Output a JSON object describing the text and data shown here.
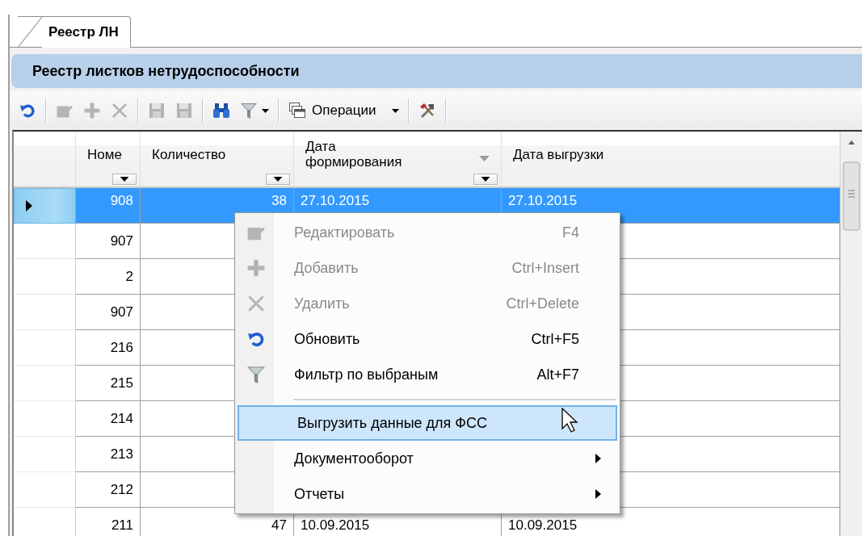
{
  "tab": {
    "label": "Реестр ЛН",
    "selected": true
  },
  "panel_title": "Реестр листков нетрудоспособности",
  "toolbar": [
    {
      "kind": "icon",
      "disabled": false
    },
    {
      "kind": "separator"
    },
    {
      "kind": "icon",
      "disabled": true
    },
    {
      "kind": "icon",
      "disabled": true
    },
    {
      "kind": "icon",
      "disabled": true
    },
    {
      "kind": "separator"
    },
    {
      "kind": "icon",
      "disabled": true
    },
    {
      "kind": "icon",
      "disabled": true
    },
    {
      "kind": "separator"
    },
    {
      "kind": "icon",
      "disabled": false
    },
    {
      "kind": "dropdown",
      "disabled": false
    },
    {
      "kind": "separator"
    },
    {
      "kind": "menu",
      "label": "Операции",
      "disabled": false
    },
    {
      "kind": "separator"
    },
    {
      "kind": "icon",
      "disabled": false
    },
    {
      "kind": "separator"
    }
  ],
  "table": {
    "columns": [
      {
        "label": "Номе",
        "filter": true,
        "sorted": false
      },
      {
        "label": "Количество",
        "filter": true,
        "sorted": false
      },
      {
        "label": "Дата\nформирования",
        "filter": true,
        "sorted": true
      },
      {
        "label": "Дата выгрузки",
        "filter": false,
        "sorted": false
      }
    ],
    "rows": [
      {
        "selected": true,
        "cells": [
          "908",
          "38",
          "27.10.2015",
          "27.10.2015"
        ]
      },
      {
        "selected": false,
        "cells": [
          "907"
        ]
      },
      {
        "selected": false,
        "cells": [
          "2"
        ]
      },
      {
        "selected": false,
        "cells": [
          "907"
        ]
      },
      {
        "selected": false,
        "cells": [
          "216"
        ]
      },
      {
        "selected": false,
        "cells": [
          "215"
        ]
      },
      {
        "selected": false,
        "cells": [
          "214"
        ]
      },
      {
        "selected": false,
        "cells": [
          "213"
        ]
      },
      {
        "selected": false,
        "cells": [
          "212"
        ]
      },
      {
        "selected": false,
        "cells": [
          "211",
          "47",
          "10.09.2015",
          "10.09.2015"
        ]
      }
    ]
  },
  "context_menu": {
    "items": [
      {
        "kind": "item",
        "label": "Редактировать",
        "shortcut": "F4",
        "disabled": true,
        "selected": false,
        "submenu": false
      },
      {
        "kind": "item",
        "label": "Добавить",
        "shortcut": "Ctrl+Insert",
        "disabled": true,
        "selected": false,
        "submenu": false
      },
      {
        "kind": "item",
        "label": "Удалить",
        "shortcut": "Ctrl+Delete",
        "disabled": true,
        "selected": false,
        "submenu": false
      },
      {
        "kind": "item",
        "label": "Обновить",
        "shortcut": "Ctrl+F5",
        "disabled": false,
        "selected": false,
        "submenu": false
      },
      {
        "kind": "item",
        "label": "Фильтр по выбраным",
        "shortcut": "Alt+F7",
        "disabled": false,
        "selected": false,
        "submenu": false
      },
      {
        "kind": "separator"
      },
      {
        "kind": "item",
        "label": "Выгрузить данные для ФСС",
        "disabled": false,
        "selected": true,
        "submenu": false
      },
      {
        "kind": "item",
        "label": "Документооборот",
        "disabled": false,
        "selected": false,
        "submenu": true
      },
      {
        "kind": "item",
        "label": "Отчеты",
        "disabled": false,
        "selected": false,
        "submenu": true
      }
    ]
  }
}
